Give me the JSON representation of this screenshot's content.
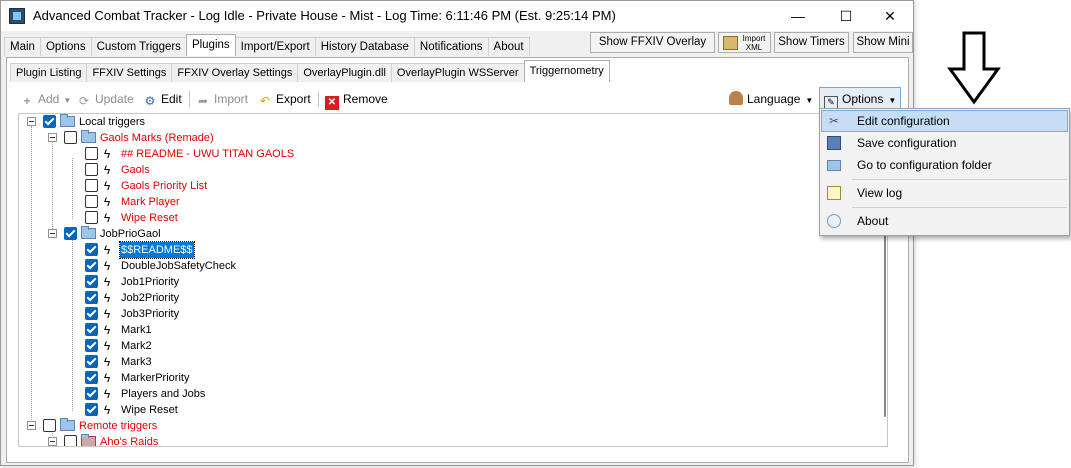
{
  "window": {
    "title": "Advanced Combat Tracker - Log Idle - Private House - Mist - Log Time: 6:11:46 PM (Est. 9:25:14 PM)",
    "controls": {
      "minimize": "—",
      "maximize": "☐",
      "close": "✕"
    }
  },
  "main_tabs": [
    "Main",
    "Options",
    "Custom Triggers",
    "Plugins",
    "Import/Export",
    "History Database",
    "Notifications",
    "About"
  ],
  "main_tab_active": "Plugins",
  "top_buttons": {
    "ffxiv_overlay": "Show FFXIV Overlay",
    "import_xml": "Import XML",
    "show_timers": "Show Timers",
    "show_mini": "Show Mini"
  },
  "sub_tabs": [
    "Plugin Listing",
    "FFXIV Settings",
    "FFXIV Overlay Settings",
    "OverlayPlugin.dll",
    "OverlayPlugin WSServer",
    "Triggernometry"
  ],
  "sub_tab_active": "Triggernometry",
  "toolbar": {
    "add": "Add",
    "update": "Update",
    "edit": "Edit",
    "import": "Import",
    "export": "Export",
    "remove": "Remove",
    "language": "Language",
    "options": "Options"
  },
  "tree": {
    "local_triggers": "Local triggers",
    "gaols_folder": "Gaols Marks (Remade)",
    "gaols_items": [
      "## README - UWU TITAN GAOLS",
      "Gaols",
      "Gaols Priority List",
      "Mark Player",
      "Wipe Reset"
    ],
    "jobprio_folder": "JobPrioGaol",
    "jobprio_items": [
      "$$README$$",
      "DoubleJobSafetyCheck",
      "Job1Priority",
      "Job2Priority",
      "Job3Priority",
      "Mark1",
      "Mark2",
      "Mark3",
      "MarkerPriority",
      "Players and Jobs",
      "Wipe Reset"
    ],
    "remote_triggers": "Remote triggers",
    "remote_item": "Aho's Raids"
  },
  "options_menu": {
    "items": [
      "Edit configuration",
      "Save configuration",
      "Go to configuration folder",
      "View log",
      "About"
    ],
    "highlighted": "Edit configuration"
  },
  "colors": {
    "accent": "#0067c0",
    "error_red": "#e00000",
    "menu_highlight": "#c5def5"
  }
}
